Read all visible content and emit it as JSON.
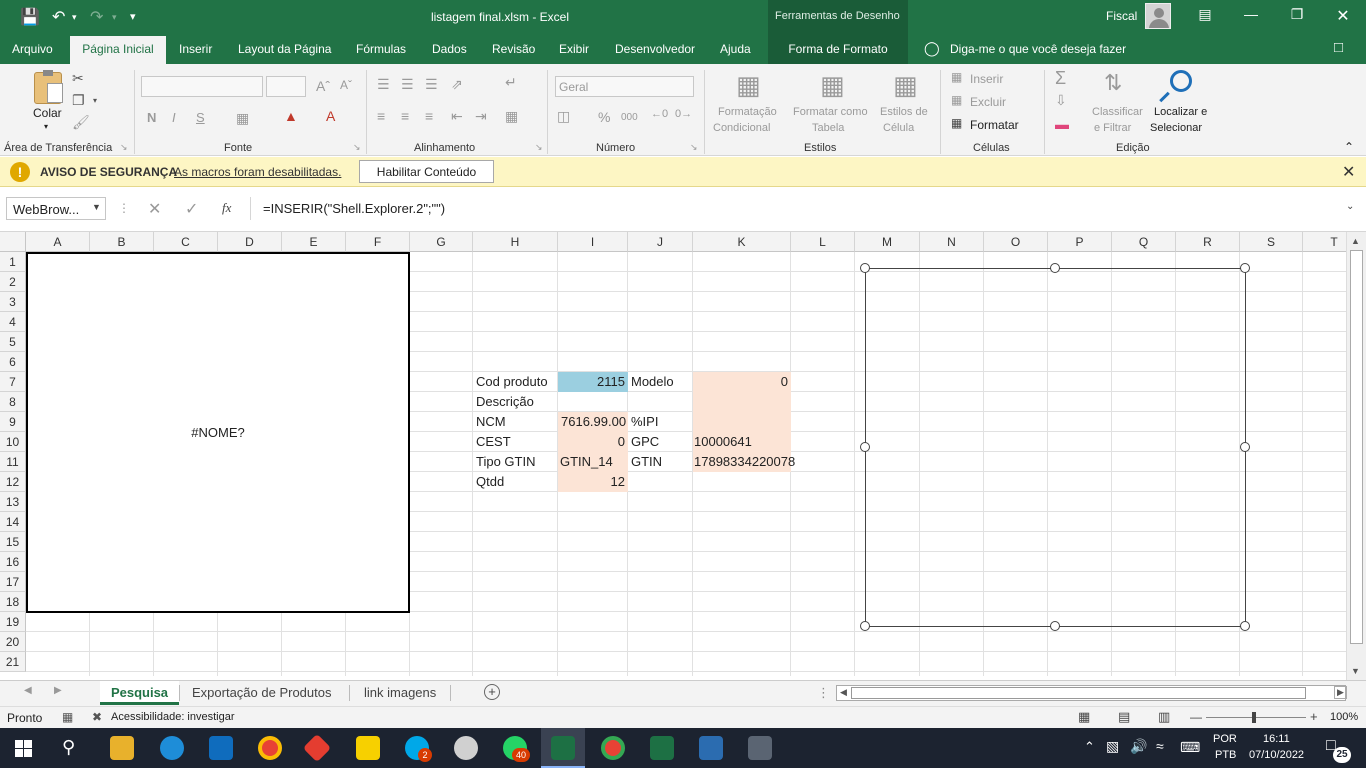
{
  "title_bar": {
    "file_title": "listagem final.xlsm  -  Excel",
    "context_tools": "Ferramentas de Desenho",
    "account": "Fiscal"
  },
  "tabs": [
    {
      "label": "Arquivo"
    },
    {
      "label": "Página Inicial"
    },
    {
      "label": "Inserir"
    },
    {
      "label": "Layout da Página"
    },
    {
      "label": "Fórmulas"
    },
    {
      "label": "Dados"
    },
    {
      "label": "Revisão"
    },
    {
      "label": "Exibir"
    },
    {
      "label": "Desenvolvedor"
    },
    {
      "label": "Ajuda"
    },
    {
      "label": "Forma de Formato"
    },
    {
      "label": "Diga-me o que você deseja fazer"
    }
  ],
  "ribbon": {
    "paste": "Colar",
    "groups": {
      "clipboard": "Área de Transferência",
      "font": "Fonte",
      "alignment": "Alinhamento",
      "number": "Número",
      "styles": "Estilos",
      "cells": "Células",
      "editing": "Edição"
    },
    "font_buttons": {
      "bold": "N",
      "italic": "I",
      "underline": "S"
    },
    "number_format": "Geral",
    "percent": "%",
    "thousands": "000",
    "styles_items": [
      "Formatação",
      "Condicional",
      "Formatar como",
      "Tabela",
      "Estilos de",
      "Célula"
    ],
    "cells_items": {
      "insert": "Inserir",
      "delete": "Excluir",
      "format": "Formatar"
    },
    "editing_items": [
      "Classificar",
      "e Filtrar",
      "Localizar e",
      "Selecionar"
    ]
  },
  "security_bar": {
    "title": "AVISO DE SEGURANÇA",
    "message": "As macros foram desabilitadas.",
    "button": "Habilitar Conteúdo"
  },
  "formula_bar": {
    "name_box": "WebBrow...",
    "formula": "=INSERIR(\"Shell.Explorer.2\";\"\")",
    "fx": "fx"
  },
  "columns": [
    "A",
    "B",
    "C",
    "D",
    "E",
    "F",
    "G",
    "H",
    "I",
    "J",
    "K",
    "L",
    "M",
    "N",
    "O",
    "P",
    "Q",
    "R",
    "S",
    "T"
  ],
  "rows": [
    "1",
    "2",
    "3",
    "4",
    "5",
    "6",
    "7",
    "8",
    "9",
    "10",
    "11",
    "12",
    "13",
    "14",
    "15",
    "16",
    "17",
    "18",
    "19",
    "20",
    "21"
  ],
  "webbrowser_value": "#NOME?",
  "cells": {
    "cod_label": "Cod produto",
    "cod_value": "2115",
    "modelo_label": "Modelo",
    "modelo_value": "0",
    "descricao_label": "Descrição",
    "ncm_label": "NCM",
    "ncm_value": "7616.99.00",
    "ipi_label": "%IPI",
    "cest_label": "CEST",
    "cest_value": "0",
    "gpc_label": "GPC",
    "gpc_value": "10000641",
    "tipo_gtin_label": "Tipo GTIN",
    "tipo_gtin_value": "GTIN_14",
    "gtin_label": "GTIN",
    "gtin_value": "17898334220078",
    "qtdd_label": "Qtdd",
    "qtdd_value": "12"
  },
  "sheet_tabs": [
    "Pesquisa",
    "Exportação de Produtos",
    "link imagens"
  ],
  "status": {
    "ready": "Pronto",
    "accessibility": "Acessibilidade: investigar",
    "zoom": "100%"
  },
  "taskbar": {
    "lang": "POR",
    "kbd": "PTB",
    "time": "16:11",
    "date": "07/10/2022",
    "notifications": "25",
    "badge_skype": "2",
    "badge_whatsapp": "40"
  },
  "colors": {
    "excel_green": "#217346",
    "cell_blue": "#9bcfe0",
    "cell_peach": "#fce4d6"
  }
}
